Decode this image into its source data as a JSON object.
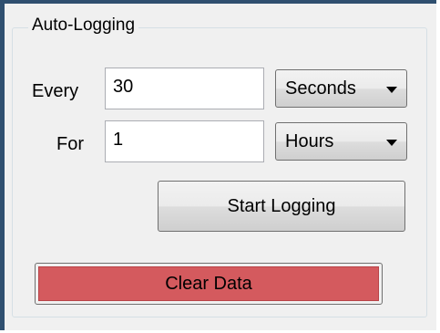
{
  "group": {
    "title": "Auto-Logging"
  },
  "every": {
    "label": "Every",
    "value": "30",
    "unit": "Seconds"
  },
  "for": {
    "label": "For",
    "value": "1",
    "unit": "Hours"
  },
  "buttons": {
    "start": "Start Logging",
    "clear": "Clear Data"
  },
  "colors": {
    "clear_bg": "#d45a5e",
    "window_border": "#2f4f6f"
  },
  "icons": {
    "dropdown": "chevron-down-icon"
  }
}
